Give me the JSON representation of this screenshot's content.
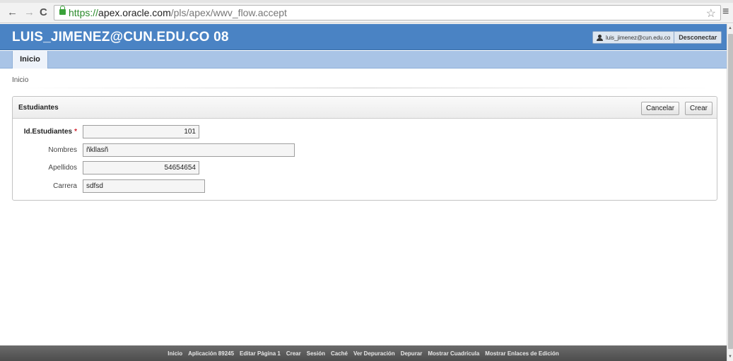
{
  "browser": {
    "url_scheme": "https://",
    "url_host": "apex.oracle.com",
    "url_path": "/pls/apex/wwv_flow.accept"
  },
  "header": {
    "title": "LUIS_JIMENEZ@CUN.EDU.CO 08",
    "user": "luis_jimenez@cun.edu.co",
    "logout_label": "Desconectar"
  },
  "tabs": [
    {
      "label": "Inicio",
      "active": true
    }
  ],
  "breadcrumb": "Inicio",
  "region": {
    "title": "Estudiantes",
    "cancel_label": "Cancelar",
    "create_label": "Crear",
    "fields": [
      {
        "label": "Id.Estudiantes",
        "required": true,
        "value": "101"
      },
      {
        "label": "Nombres",
        "required": false,
        "value": "ñkllasñ"
      },
      {
        "label": "Apellidos",
        "required": false,
        "value": "54654654"
      },
      {
        "label": "Carrera",
        "required": false,
        "value": "sdfsd"
      }
    ]
  },
  "dev_toolbar": [
    "Inicio",
    "Aplicación 89245",
    "Editar Página 1",
    "Crear",
    "Sesión",
    "Caché",
    "Ver Depuración",
    "Depurar",
    "Mostrar Cuadrícula",
    "Mostrar Enlaces de Edición"
  ],
  "colors": {
    "header_bg": "#4a83c4",
    "tab_bar_bg": "#a9c4e6",
    "required_star": "#d0202d",
    "dev_bar_bg": "#555555"
  }
}
